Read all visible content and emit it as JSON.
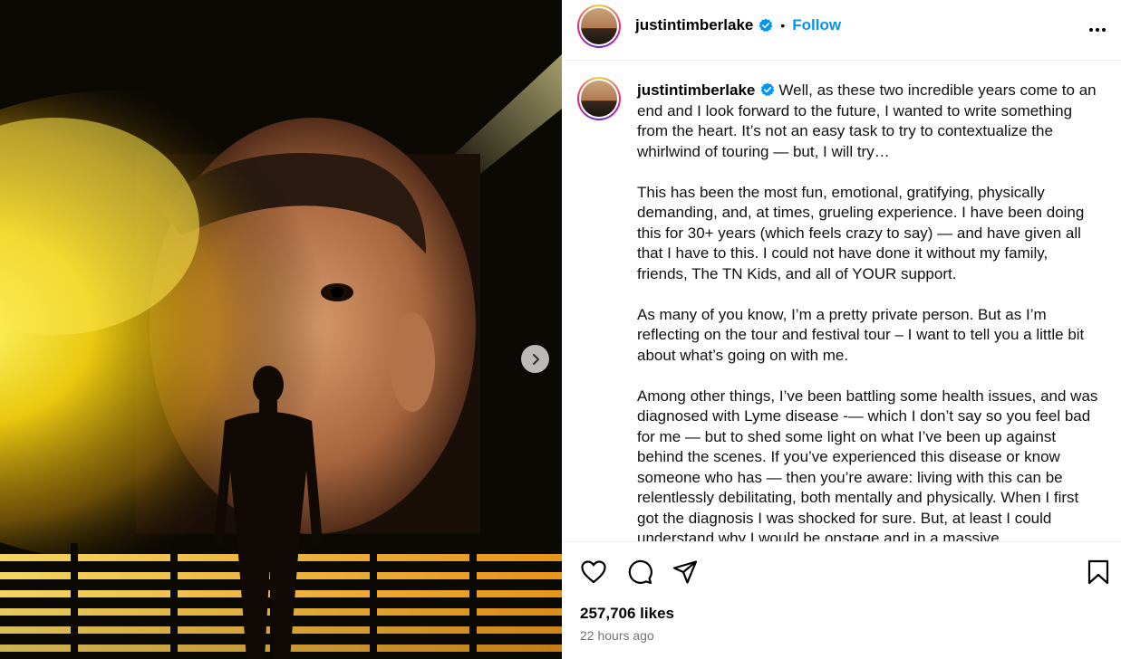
{
  "post": {
    "username": "justintimberlake",
    "follow_label": "Follow",
    "separator": "•",
    "caption_paragraphs": [
      "Well, as these two incredible years come to an end and I look forward to the future, I wanted to write something from the heart. It’s not an easy task to try to contextualize the whirlwind of touring — but, I will try…",
      "This has been the most fun, emotional, gratifying, physically demanding, and, at times, grueling experience. I have been doing this for 30+ years (which feels crazy to say) — and have given all that I have to this. I could not have done it without my family, friends, The TN Kids, and all of YOUR support.",
      "As many of you know, I’m a pretty private person. But as I’m reflecting on the tour and festival tour – I want to tell you a little bit about what’s going on with me.",
      "Among other things, I’ve been battling some health issues, and was diagnosed with Lyme disease -— which I don’t say so you feel bad for me — but to shed some light on what I’ve been up against behind the scenes. If you’ve experienced this disease or know someone who has — then you’re aware: living with this can be relentlessly debilitating, both mentally and physically. When I first got the diagnosis I was shocked for sure. But, at least I could understand why I would be onstage and in a massive"
    ],
    "likes": "257,706 likes",
    "timestamp": "22 hours ago"
  },
  "icons": {
    "verified": "verified-badge-icon",
    "more": "more-options-icon",
    "like": "heart-icon",
    "comment": "comment-icon",
    "share": "send-icon",
    "save": "bookmark-icon",
    "next": "chevron-right-icon"
  },
  "colors": {
    "follow": "#0095f6",
    "verified": "#0095f6",
    "timestamp": "#737373"
  }
}
